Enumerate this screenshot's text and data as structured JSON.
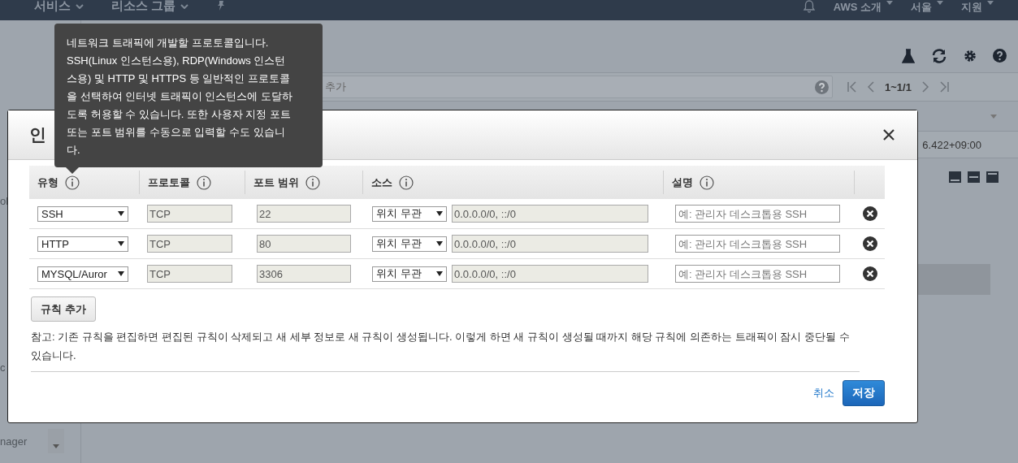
{
  "nav": {
    "left": [
      {
        "label": "서비스"
      },
      {
        "label": "리소스 그룹"
      }
    ],
    "right": [
      {
        "label": "AWS 소개"
      },
      {
        "label": "서울"
      },
      {
        "label": "지원"
      }
    ]
  },
  "background": {
    "sidebar_fragments": [
      "ol",
      "c",
      "nager"
    ],
    "search_text": "추가",
    "pagination": "1~1/1",
    "cell_text": "6.422+09:00"
  },
  "modal": {
    "title": "인",
    "columns": [
      "유형",
      "프로토콜",
      "포트 범위",
      "소스",
      "설명"
    ],
    "rules": [
      {
        "type": "SSH",
        "protocol": "TCP",
        "port_range": "22",
        "source": "위치 무관",
        "cidr": "0.0.0.0/0, ::/0",
        "placeholder": "예: 관리자 데스크톱용 SSH"
      },
      {
        "type": "HTTP",
        "protocol": "TCP",
        "port_range": "80",
        "source": "위치 무관",
        "cidr": "0.0.0.0/0, ::/0",
        "placeholder": "예: 관리자 데스크톱용 SSH"
      },
      {
        "type": "MYSQL/Auror",
        "protocol": "TCP",
        "port_range": "3306",
        "source": "위치 무관",
        "cidr": "0.0.0.0/0, ::/0",
        "placeholder": "예: 관리자 데스크톱용 SSH"
      }
    ],
    "add_button": "규칙 추가",
    "note": "참고: 기존 규칙을 편집하면 편집된 규칙이 삭제되고 새 세부 정보로 새 규칙이 생성됩니다. 이렇게 하면 새 규칙이 생성될 때까지 해당 규칙에 의존하는 트래픽이 잠시 중단될 수 있습니다.",
    "cancel": "취소",
    "save": "저장"
  },
  "tooltip": {
    "lines": [
      "네트워크 트래픽에 개발할 프로토콜입니다.",
      "SSH(Linux 인스턴스용), RDP(Windows 인스턴",
      "스용) 및 HTTP 및 HTTPS 등 일반적인 프로토콜",
      "을 선택하여 인터넷 트래픽이 인스턴스에 도달하",
      "도록 허용할 수 있습니다. 또한 사용자 지정 포트",
      "또는 포트 범위를 수동으로 입력할 수도 있습니",
      "다."
    ]
  }
}
